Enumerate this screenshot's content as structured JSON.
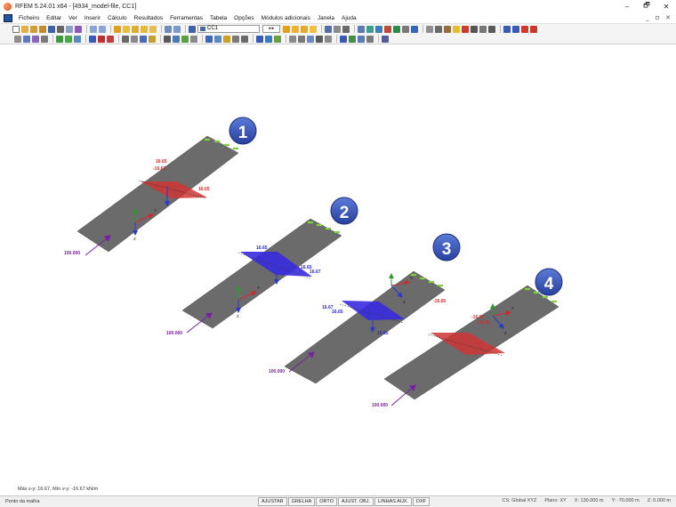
{
  "window": {
    "title": "RFEM 5.24.01 x64 - [4934_model-file, CC1]",
    "min": "–",
    "max": "🗗",
    "close": "✕"
  },
  "menu": [
    "Ficheiro",
    "Editar",
    "Ver",
    "Inserir",
    "Cálculo",
    "Resultados",
    "Ferramentas",
    "Tabela",
    "Opções",
    "Módulos adicionais",
    "Janela",
    "Ajuda"
  ],
  "menu_right": "_ ㅁ ✕",
  "toolbar": {
    "load_case": "CC1",
    "arrows": "◂ ▸"
  },
  "model": {
    "badges": [
      "1",
      "2",
      "3",
      "4"
    ],
    "load_value": "100.000",
    "max_value": "16.65",
    "min_value": "-16.67",
    "values_2": [
      "16.65",
      "16.65",
      "16.67"
    ],
    "values_3": [
      "16.67",
      "16.65",
      "16.65"
    ],
    "values_4": [
      "-16.65",
      "-16.67",
      "-16.65"
    ],
    "axis_x": "X",
    "axis_y": "Y",
    "axis_z": "Z",
    "colors": {
      "plate": "#6b6b6b",
      "positive": "#3a2be0",
      "negative": "#d02a2a",
      "load": "#7a1fa2",
      "support": "#7bd23c",
      "badge": "#3a55b8"
    }
  },
  "info_line": "Máx v-y: 16.67, Mín v-y: -16.67 kN/m",
  "status": {
    "text": "Ponto da malha",
    "buttons": [
      "AJUSTAR",
      "GRELHA",
      "ORTO",
      "AJUST. OBJ.",
      "LINHAS AUX.",
      "DXF"
    ],
    "cs": "CS: Global XYZ",
    "plane": "Plano: XY",
    "x": "X: 130.000 m",
    "y": "Y: -70.000 m",
    "z": "Z: 0.000 m"
  }
}
